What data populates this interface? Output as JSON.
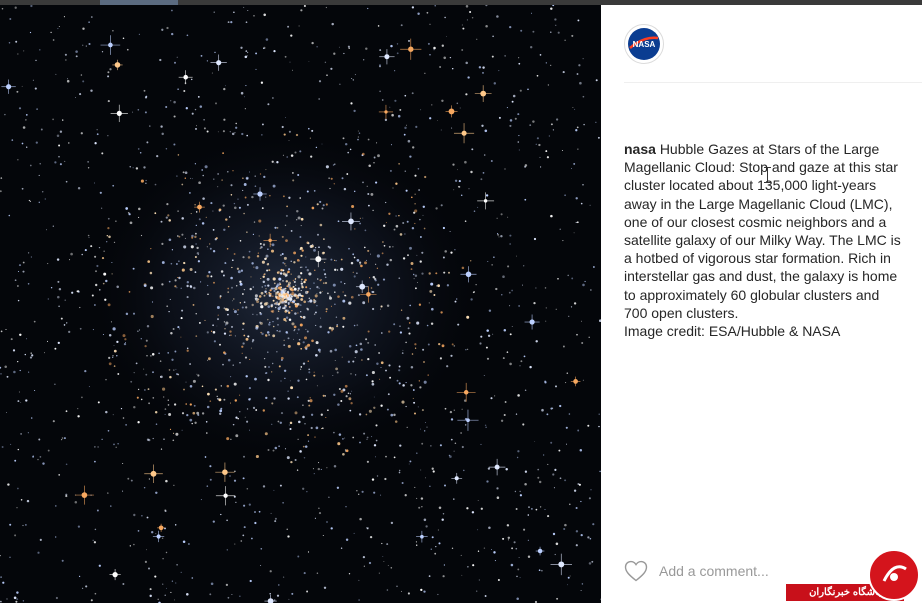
{
  "photo": {
    "subject": "star-cluster-photo"
  },
  "post": {
    "username": "nasa",
    "caption_text": "Hubble Gazes at Stars of the Large Magellanic Cloud: Stop and gaze at this star cluster located about 135,000 light-years away in the Large Magellanic Cloud (LMC), one of our closest cosmic neighbors and a satellite galaxy of our Milky Way. The LMC is a hotbed of vigorous star formation. Rich in interstellar gas and dust, the galaxy is home to approximately 60 globular clusters and 700 open clusters.",
    "image_credit": "Image credit: ESA/Hubble & NASA"
  },
  "avatar": {
    "logo_text": "NASA"
  },
  "comment": {
    "placeholder": "Add a comment..."
  },
  "watermark": {
    "text": "باشگاه خبرنگاران"
  },
  "colors": {
    "nasa_blue": "#0b3d91",
    "nasa_red": "#fc3d21",
    "watermark_red": "#c8101a"
  },
  "icons": {
    "like": "heart-icon"
  }
}
